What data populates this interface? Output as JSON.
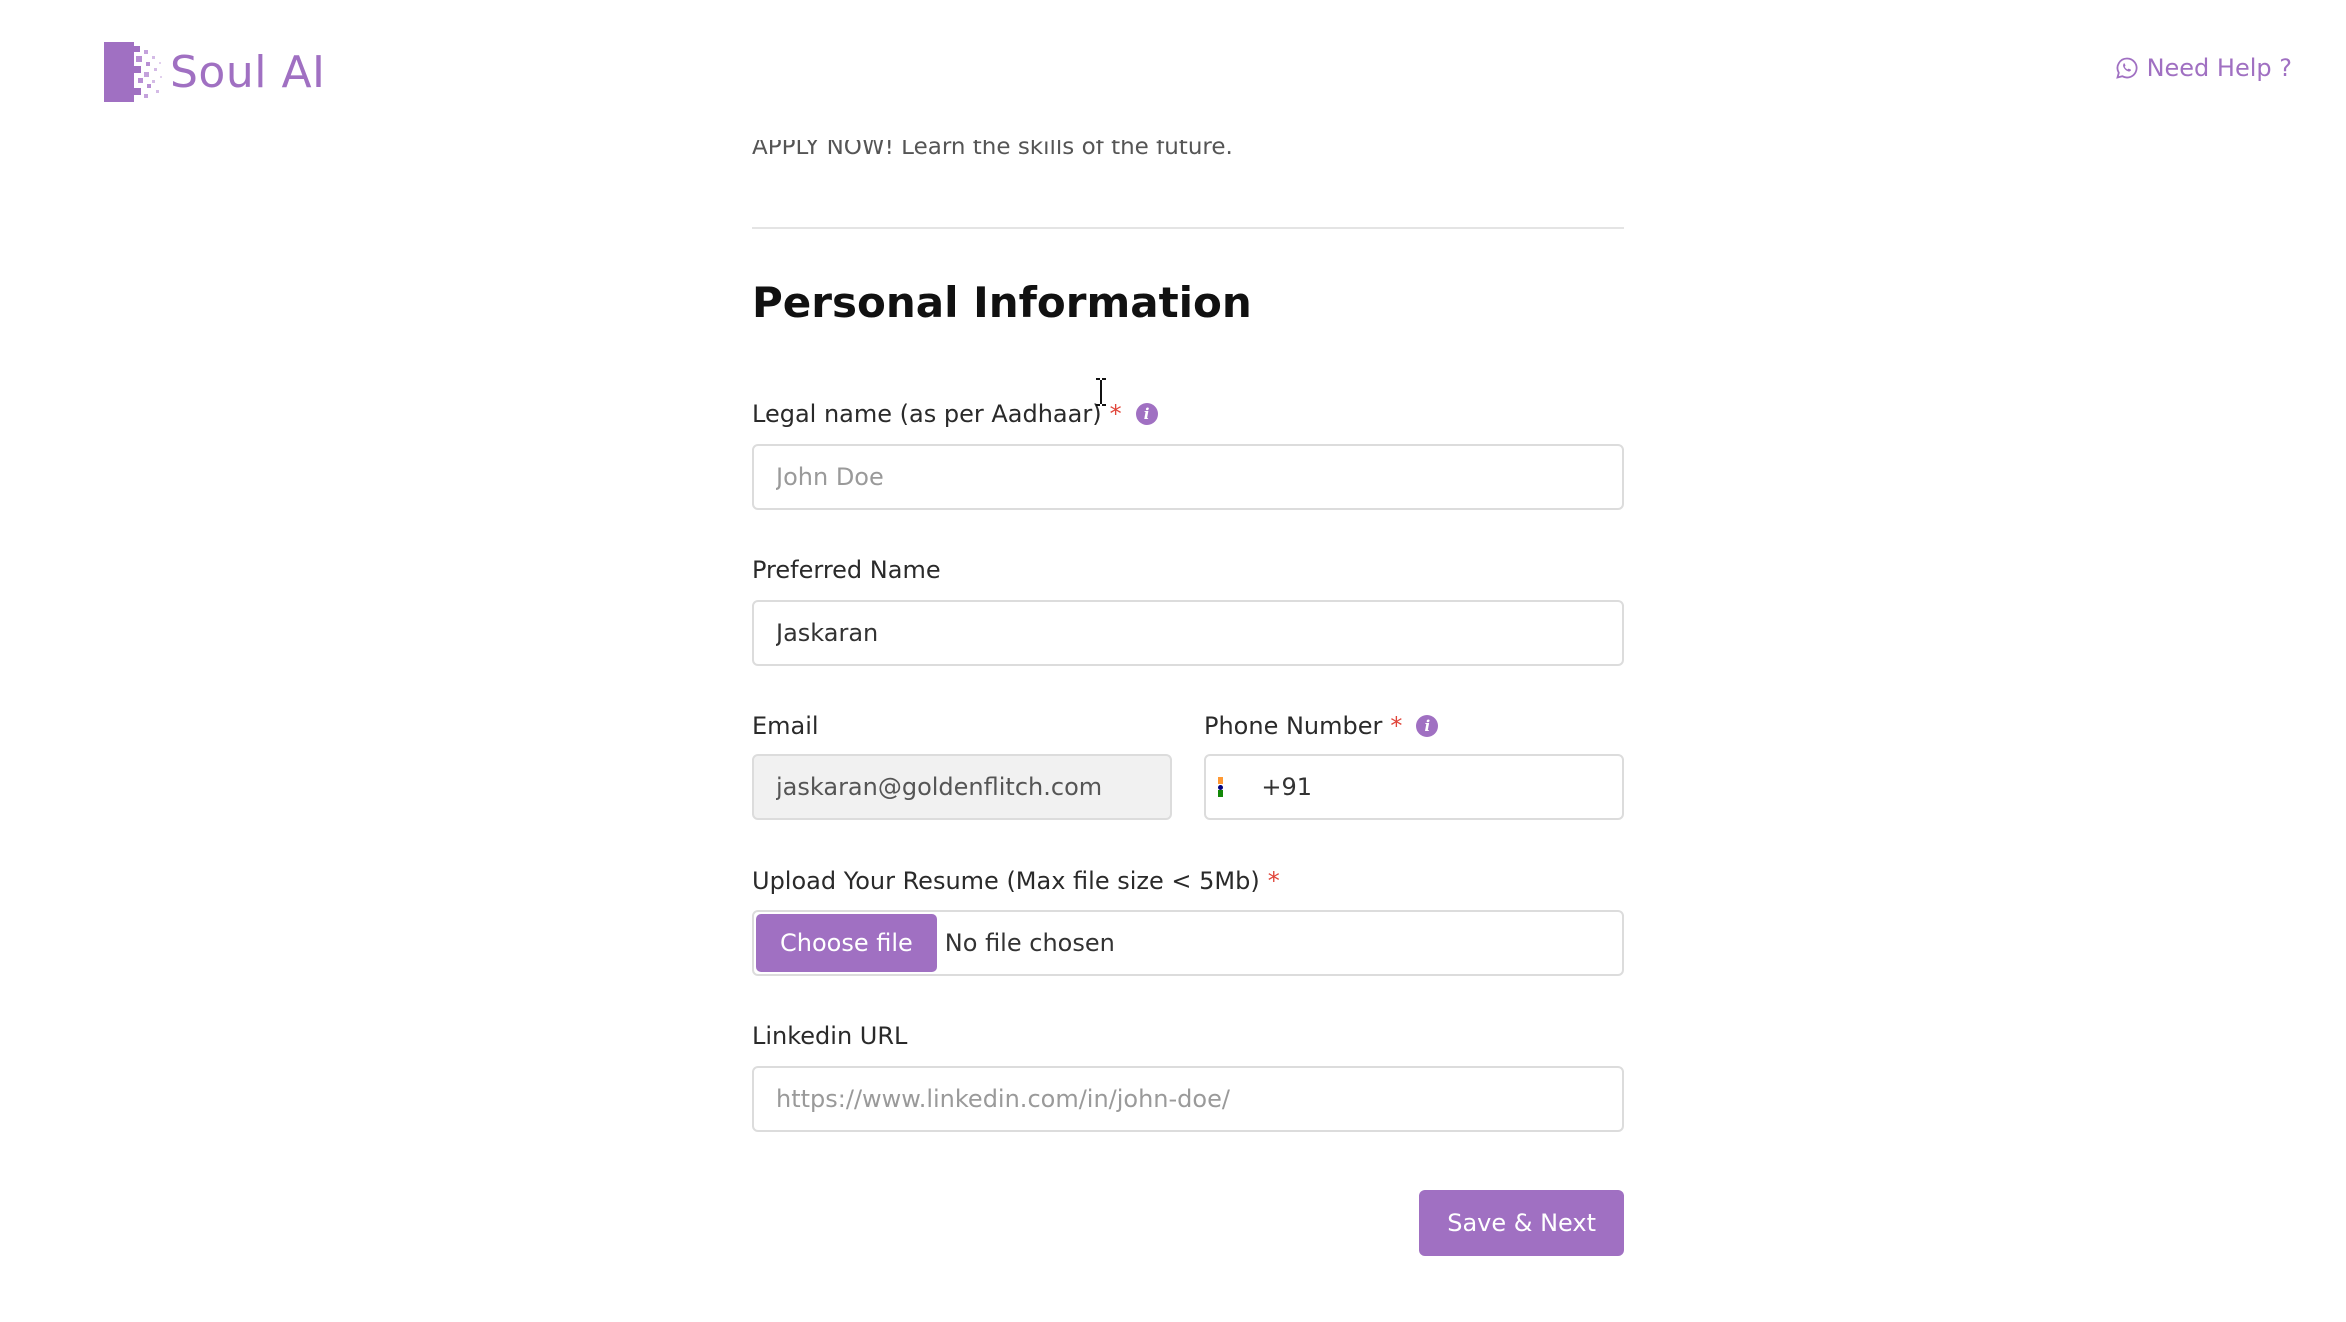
{
  "header": {
    "logo_text": "Soul AI",
    "help_label": "Need Help ?"
  },
  "intro": {
    "tagline": "APPLY NOW! Learn the skills of the future."
  },
  "section": {
    "title": "Personal Information"
  },
  "fields": {
    "legal_name": {
      "label": "Legal name (as per Aadhaar)",
      "required_mark": "*",
      "placeholder": "John Doe",
      "value": ""
    },
    "preferred_name": {
      "label": "Preferred Name",
      "value": "Jaskaran"
    },
    "email": {
      "label": "Email",
      "value": "jaskaran@goldenflitch.com"
    },
    "phone": {
      "label": "Phone Number",
      "required_mark": "*",
      "dial_code": "+91",
      "value": ""
    },
    "resume": {
      "label": "Upload Your Resume (Max file size < 5Mb)",
      "required_mark": "*",
      "button_label": "Choose file",
      "status": "No file chosen"
    },
    "linkedin": {
      "label": "Linkedin URL",
      "placeholder": "https://www.linkedin.com/in/john-doe/",
      "value": ""
    }
  },
  "actions": {
    "save_label": "Save & Next"
  },
  "theme": {
    "accent": "#a070c2",
    "required": "#e0453a"
  },
  "icons": {
    "logo": "pixel-mosaic-logo-icon",
    "help": "whatsapp-icon",
    "info": "info-icon",
    "flag": "india-flag-icon",
    "cursor": "text-cursor-icon"
  }
}
